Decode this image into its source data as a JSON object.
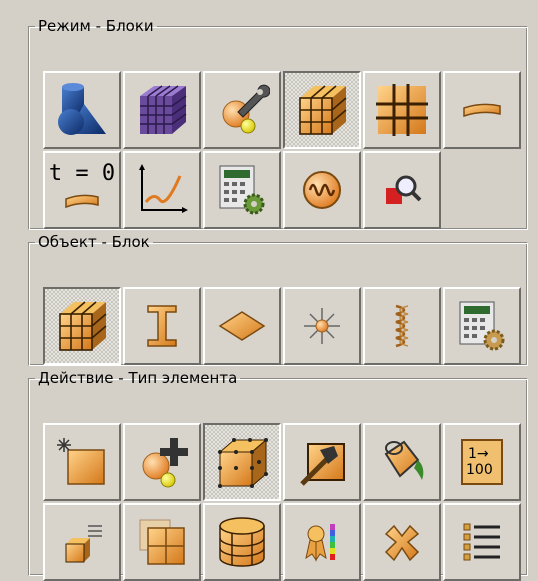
{
  "groups": {
    "mode": {
      "title": "Режим - Блоки",
      "buttons": [
        {
          "icon": "geometry-shapes-icon",
          "pressed": false
        },
        {
          "icon": "purple-mesh-cube-icon",
          "pressed": false
        },
        {
          "icon": "wrench-tools-icon",
          "pressed": false
        },
        {
          "icon": "block-cube-icon",
          "pressed": true
        },
        {
          "icon": "grid-block-icon",
          "pressed": false
        },
        {
          "icon": "strip-icon",
          "pressed": false
        },
        {
          "icon": "time-zero-icon",
          "pressed": false,
          "label": "t = 0"
        },
        {
          "icon": "xy-plot-icon",
          "pressed": false
        },
        {
          "icon": "calculator-settings-icon",
          "pressed": false
        },
        {
          "icon": "waveform-icon",
          "pressed": false
        },
        {
          "icon": "zoom-search-icon",
          "pressed": false
        }
      ]
    },
    "object": {
      "title": "Объект - Блок",
      "buttons": [
        {
          "icon": "block-cube-icon",
          "pressed": true
        },
        {
          "icon": "i-beam-icon",
          "pressed": false
        },
        {
          "icon": "face-diamond-icon",
          "pressed": false
        },
        {
          "icon": "point-vertex-icon",
          "pressed": false
        },
        {
          "icon": "spring-coil-icon",
          "pressed": false
        },
        {
          "icon": "calculator-settings-icon",
          "pressed": false
        }
      ]
    },
    "action": {
      "title": "Действие - Тип элемента",
      "buttons": [
        {
          "icon": "new-block-icon",
          "pressed": false
        },
        {
          "icon": "add-vertex-icon",
          "pressed": false
        },
        {
          "icon": "cube-vertices-icon",
          "pressed": true
        },
        {
          "icon": "hammer-edit-icon",
          "pressed": false
        },
        {
          "icon": "paint-bucket-icon",
          "pressed": false
        },
        {
          "icon": "numbering-icon",
          "pressed": false,
          "label": "1→ 100"
        },
        {
          "icon": "small-cube-list-icon",
          "pressed": false
        },
        {
          "icon": "split-block-icon",
          "pressed": false
        },
        {
          "icon": "cylinder-block-icon",
          "pressed": false
        },
        {
          "icon": "quality-ribbon-icon",
          "pressed": false
        },
        {
          "icon": "delete-x-icon",
          "pressed": false
        },
        {
          "icon": "list-icon",
          "pressed": false
        }
      ]
    }
  },
  "colors": {
    "panel": "#d4d0c8",
    "orange": "#e8a040",
    "orange_dark": "#7a4a10",
    "purple": "#6a4a9a",
    "blue": "#1f4fa0"
  }
}
